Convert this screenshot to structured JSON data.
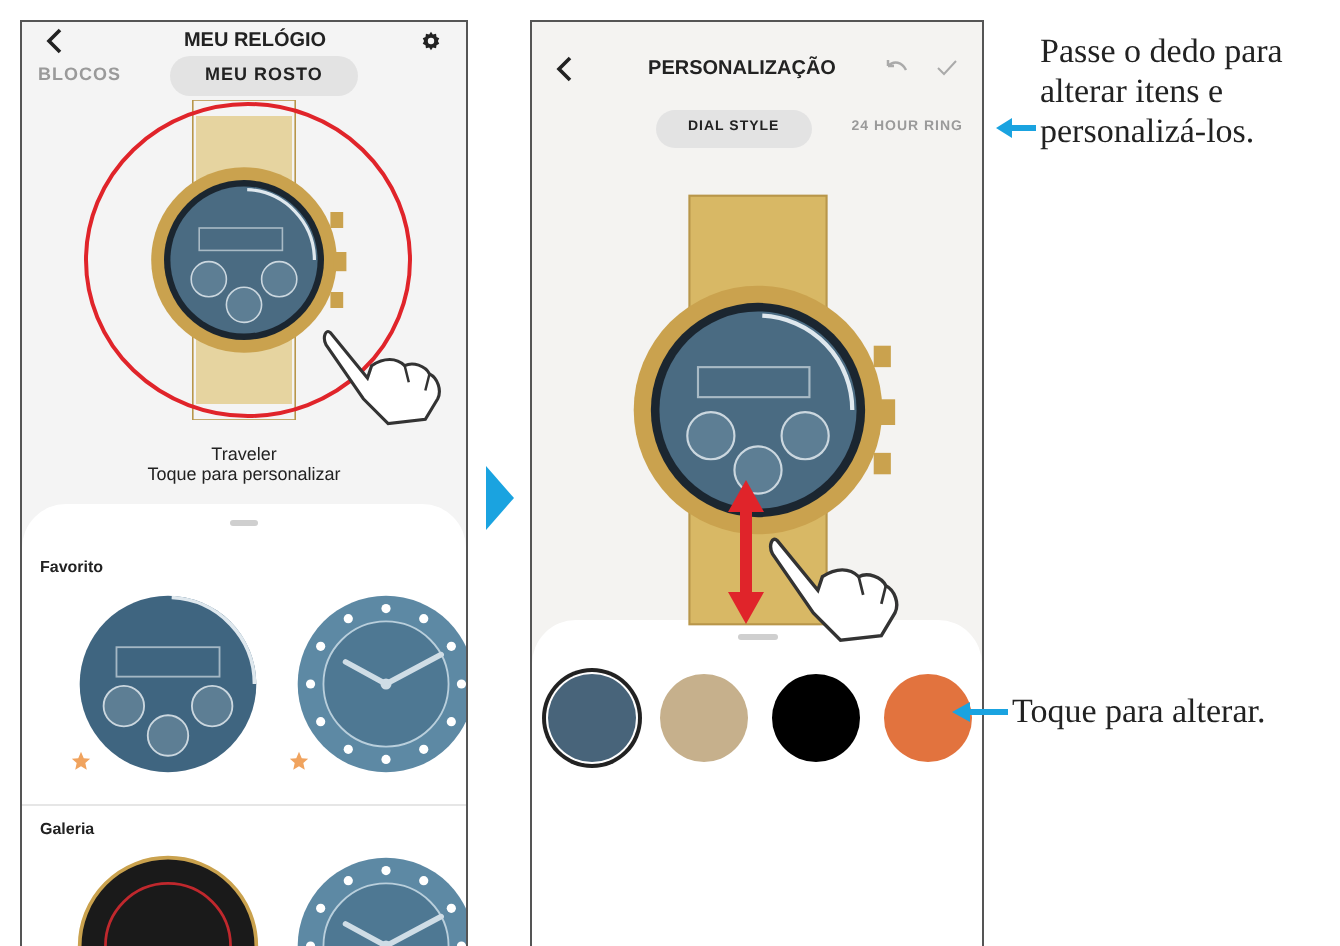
{
  "screens": [
    {
      "title": "MEU RELÓGIO",
      "actions": [
        {
          "kind": "settings"
        }
      ],
      "tabs": [
        {
          "label": "BLOCOS",
          "selected": false
        },
        {
          "label": "MEU ROSTO",
          "selected": true
        }
      ],
      "highlighted": true,
      "face_name": "Traveler",
      "hint": "Toque para personalizar",
      "sections": [
        {
          "title": "Favorito",
          "faces": [
            {
              "kind": "digital",
              "favorite": true
            },
            {
              "kind": "analog",
              "favorite": true
            }
          ]
        },
        {
          "title": "Galeria",
          "faces": [
            {
              "kind": "dark"
            },
            {
              "kind": "analog"
            }
          ]
        }
      ]
    },
    {
      "title": "PERSONALIZAÇÃO",
      "actions": [
        {
          "kind": "undo"
        },
        {
          "kind": "confirm"
        }
      ],
      "tabs": [
        {
          "label": "DIAL STYLE",
          "selected": true
        },
        {
          "label": "24 HOUR RING",
          "selected": false
        }
      ],
      "swipe_arrow": true,
      "swatches": [
        {
          "color": "#48647a",
          "selected": true
        },
        {
          "color": "#c6b08c",
          "selected": false
        },
        {
          "color": "#000000",
          "selected": false
        },
        {
          "color": "#e2733e",
          "selected": false
        }
      ]
    }
  ],
  "annotations": [
    {
      "text": "Passe o dedo para alterar itens e personalizá-los."
    },
    {
      "text": "Toque para alterar."
    }
  ]
}
